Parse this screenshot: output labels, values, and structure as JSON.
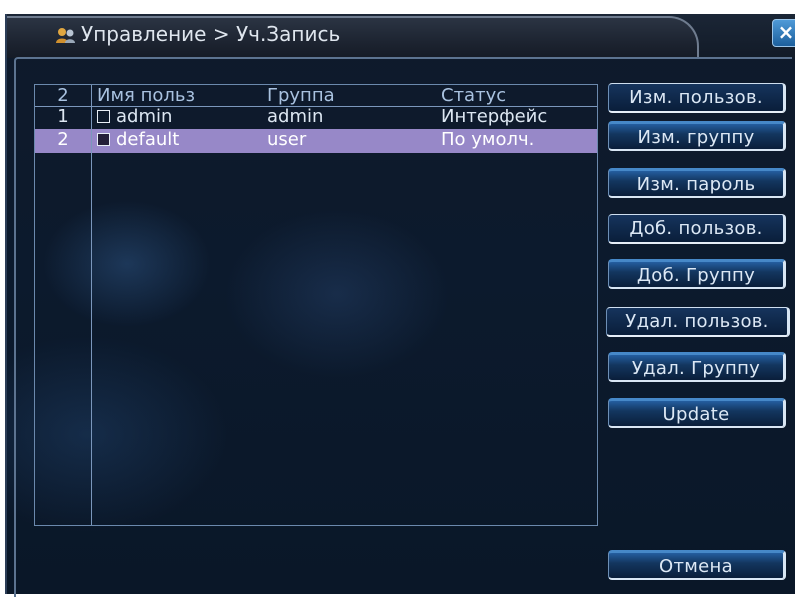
{
  "window": {
    "title": "Управление > Уч.Запись",
    "title_icon": "user-icon",
    "close_label": "×"
  },
  "table": {
    "headers": {
      "count": "2",
      "name": "Имя польз",
      "group": "Группа",
      "status": "Статус"
    },
    "rows": [
      {
        "num": "1",
        "name": "admin",
        "group": "admin",
        "status": "Интерфейс",
        "selected": false
      },
      {
        "num": "2",
        "name": "default",
        "group": "user",
        "status": "По умолч.",
        "selected": true
      }
    ],
    "selected_row_color": "#9788c8"
  },
  "buttons": {
    "edit_user": "Изм. пользов.",
    "edit_group": "Изм. группу",
    "edit_password": "Изм. пароль",
    "add_user": "Доб. пользов.",
    "add_group": "Доб. Группу",
    "delete_user": "Удал. пользов.",
    "delete_group": "Удал. Группу",
    "update": "Update",
    "cancel": "Отмена"
  },
  "colors": {
    "background": "#0c1a2d",
    "accent": "#2f7fd0",
    "text": "#dde7f2"
  }
}
